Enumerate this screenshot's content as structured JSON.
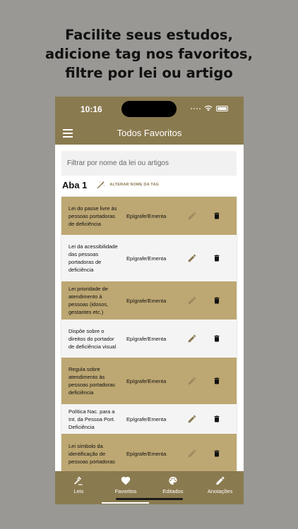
{
  "promo": {
    "lines": [
      "Facilite seus estudos,",
      "adicione tag nos favoritos,",
      "filtre por lei ou artigo"
    ]
  },
  "status": {
    "time": "10:16"
  },
  "appbar": {
    "title": "Todos Favoritos"
  },
  "search": {
    "placeholder": "Filtrar por nome da lei ou artigos"
  },
  "tag": {
    "name": "Aba 1",
    "rename_label": "ALTERAR NOME DA TAG"
  },
  "favorites": [
    {
      "title": "Lei do passe livre às pessoas portadoras de deficiência",
      "type": "Epígrafe/Ementa",
      "style": "gold"
    },
    {
      "title": "Lei da acessibilidade das pessoas portadoras de deficiência",
      "type": "Epígrafe/Ementa",
      "style": "light"
    },
    {
      "title": "Lei prioridade de atendimento à pessoas (idosos, gestantes etc.)",
      "type": "Epígrafe/Ementa",
      "style": "gold"
    },
    {
      "title": "Dispõe sobre o direitos do portador de deficiência visual",
      "type": "Epígrafe/Ementa",
      "style": "light"
    },
    {
      "title": "Regula sobre atendimento às pessoas portadoras deficiência",
      "type": "Epígrafe/Ementa",
      "style": "gold"
    },
    {
      "title": "Política Nac. para a Int. da Pessoa Port. Deficiência",
      "type": "Epígrafe/Ementa",
      "style": "light"
    },
    {
      "title": "Lei símbolo da identificação de pessoas portadoras",
      "type": "Epígrafe/Ementa",
      "style": "gold"
    }
  ],
  "nav": [
    {
      "label": "Leis",
      "icon": "gavel-icon"
    },
    {
      "label": "Favoritos",
      "icon": "heart-icon"
    },
    {
      "label": "Editados",
      "icon": "palette-icon"
    },
    {
      "label": "Anotações",
      "icon": "pencil-icon"
    }
  ],
  "colors": {
    "primary": "#8a7a4f",
    "row_gold": "#bda772",
    "row_light": "#f4f4f4",
    "background": "#999894"
  }
}
